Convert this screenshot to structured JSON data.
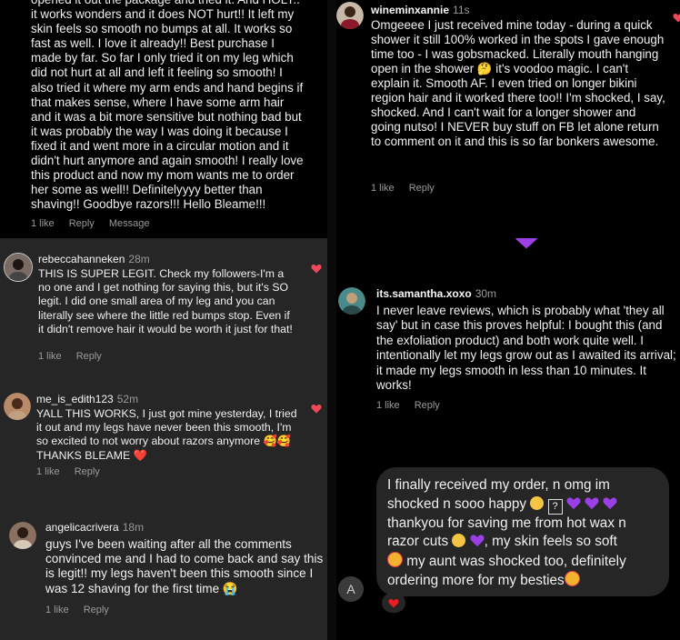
{
  "top_left": {
    "comment_text": "opened it out the package and tried it. And HOLY.. it works wonders and it does NOT hurt!! It left my skin feels so smooth no bumps at all. It works so fast as well. I love it already!! Best purchase I made by far. So far I only tried it on my leg which did not hurt at all and left it feeling so smooth! I also tried it where my arm ends and hand begins if that makes sense, where I have some arm hair and it was a bit more sensitive but nothing bad but it was probably the way I was doing it because I fixed it and went more in a circular motion and it didn't hurt anymore and again smooth! I really love this product and now my mom wants me to order her some as well!! Definitelyyyy better than shaving!! Goodbye razors!!! Hello Bleame!!!",
    "likes": "1 like",
    "reply": "Reply",
    "message": "Message"
  },
  "top_right": {
    "username": "wineminxannie",
    "time": "11s",
    "comment_text": "Omgeeee I just received mine today - during a quick shower it still 100% worked in the spots I gave enough time too - I was gobsmacked. Literally mouth hanging open in the shower 🤔 it's voodoo magic. I can't explain it. Smooth AF. I even tried on longer bikini region hair and it worked there too!! I'm shocked, I say, shocked. And I can't wait for a longer shower and going nutso! I NEVER buy stuff on FB let alone return to comment on it and this is so far bonkers awesome.",
    "likes": "1 like",
    "reply": "Reply"
  },
  "bottom_left": {
    "comments": [
      {
        "username": "rebeccahanneken",
        "time": "28m",
        "text": "THIS IS SUPER LEGIT. Check my followers-I'm a no one and I get nothing for saying this, but it's SO legit. I did one small area of my leg and you can literally see where the little red bumps stop. Even if it didn't remove hair it would be worth it just for that!",
        "likes": "1 like",
        "reply": "Reply"
      },
      {
        "username": "me_is_edith123",
        "time": "52m",
        "text": "YALL THIS WORKS, I just got mine yesterday, I tried it out and my legs have never been this smooth, I'm so excited to not worry about razors anymore 🥰🥰 THANKS BLEAME ❤️",
        "likes": "1 like",
        "reply": "Reply"
      },
      {
        "username": "angelicacrivera",
        "time": "18m",
        "text": "guys I've been waiting after all the comments convinced me and I had to come back and say this is legit!! my legs haven't been this smooth since I was 12 shaving for the first time 😭",
        "likes": "1 like",
        "reply": "Reply"
      }
    ]
  },
  "bottom_right": {
    "username": "its.samantha.xoxo",
    "time": "30m",
    "comment_text": "I never leave reviews, which is probably what 'they all say' but in case this proves helpful: I bought this (and the exfoliation product) and both work quite well. I intentionally let my legs grow out as I awaited its arrival; it made my legs smooth in less than 10 minutes. It works!",
    "likes": "1 like",
    "reply": "Reply",
    "message_line1": "I finally received my order, n omg im",
    "message_line2": "shocked n sooo happy",
    "message_line3": "thankyou for saving me from hot wax n",
    "message_line4": "razor cuts",
    "message_line4b": ", my skin feels so soft",
    "message_line5": " my aunt was shocked too, definitely",
    "message_line6": "ordering more for my besties",
    "qmark": "?"
  },
  "colors": {
    "heart_red": "#ed4956",
    "purple": "#9b3fe6",
    "meta_gray": "#9a9a9a"
  }
}
